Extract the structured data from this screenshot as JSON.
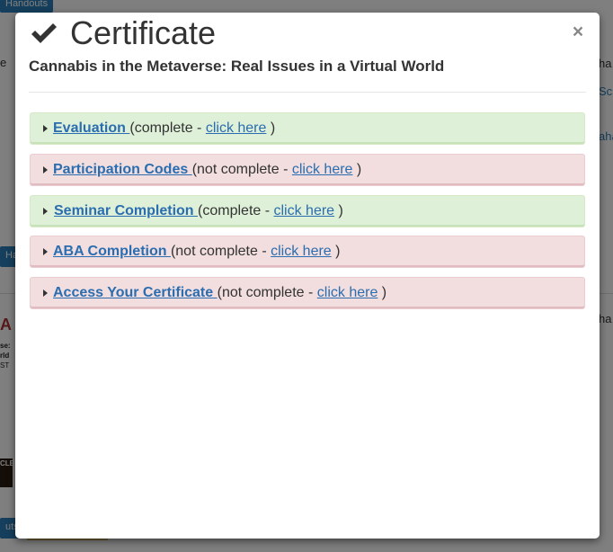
{
  "background": {
    "top_button": "Handouts",
    "side_button_1": "Ha",
    "side_button_2": "uts",
    "right_text_1": "ha",
    "right_link_1": "Sch",
    "right_link_2": "aha",
    "right_text_2": "ha",
    "left_text_1": "e",
    "logo_line1": "A",
    "logo_line2": "se:",
    "logo_line3": "rld",
    "logo_line4": "ST",
    "dark_logo_text": "CLE"
  },
  "modal": {
    "title": "Certificate",
    "close_label": "×",
    "seminar_title": "Cannabis in the Metaverse: Real Issues in a Virtual World",
    "rows": [
      {
        "title": "Evaluation ",
        "status": "(complete - ",
        "link": "click here",
        "suffix": " )"
      },
      {
        "title": "Participation Codes ",
        "status": "(not complete - ",
        "link": "click here",
        "suffix": " )"
      },
      {
        "title": "Seminar Completion ",
        "status": "(complete - ",
        "link": "click here",
        "suffix": " )"
      },
      {
        "title": "ABA Completion ",
        "status": "(not complete - ",
        "link": "click here",
        "suffix": " )"
      },
      {
        "title": "Access Your Certificate ",
        "status": "(not complete - ",
        "link": "click here",
        "suffix": " )"
      }
    ]
  },
  "colors": {
    "complete_bg": "#dff0d8",
    "incomplete_bg": "#f2dede",
    "link": "#2a6db0",
    "button": "#2a7fb8"
  }
}
